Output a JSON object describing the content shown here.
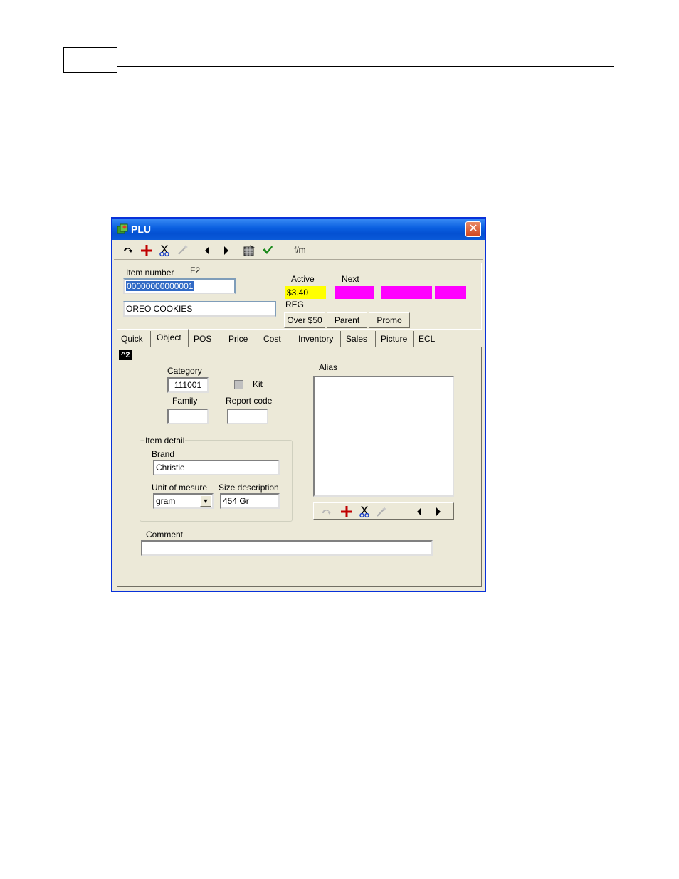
{
  "window": {
    "title": "PLU",
    "close_glyph": "✕"
  },
  "toolbar": {
    "icons": [
      "undo-icon",
      "add-icon",
      "cut-icon",
      "wand-icon",
      "prev-icon",
      "next-icon",
      "grid-icon",
      "check-icon"
    ],
    "fm_label": "f/m"
  },
  "header": {
    "item_number_label": "Item number",
    "f2_label": "F2",
    "item_number_value": "00000000000001",
    "description_value": "OREO COOKIES",
    "active_label": "Active",
    "next_label": "Next",
    "active_price": "$3.40",
    "price_type": "REG",
    "buttons": {
      "over": "Over $50",
      "parent": "Parent",
      "promo": "Promo"
    },
    "colors": {
      "active_price_bg": "#ffff00",
      "next_price_bg": "#ff00ff"
    }
  },
  "tabs": [
    "Quick",
    "Object",
    "POS",
    "Price",
    "Cost",
    "Inventory",
    "Sales",
    "Picture",
    "ECL"
  ],
  "active_tab": "Object",
  "object_tab": {
    "badge": "^2",
    "category_label": "Category",
    "category_value": "111001",
    "kit_label": "Kit",
    "family_label": "Family",
    "family_value": "",
    "report_code_label": "Report code",
    "report_code_value": "",
    "item_detail_title": "Item detail",
    "brand_label": "Brand",
    "brand_value": "Christie",
    "unit_label": "Unit of mesure",
    "unit_value": "gram",
    "size_label": "Size description",
    "size_value": "454 Gr",
    "alias_label": "Alias",
    "comment_label": "Comment",
    "comment_value": ""
  }
}
